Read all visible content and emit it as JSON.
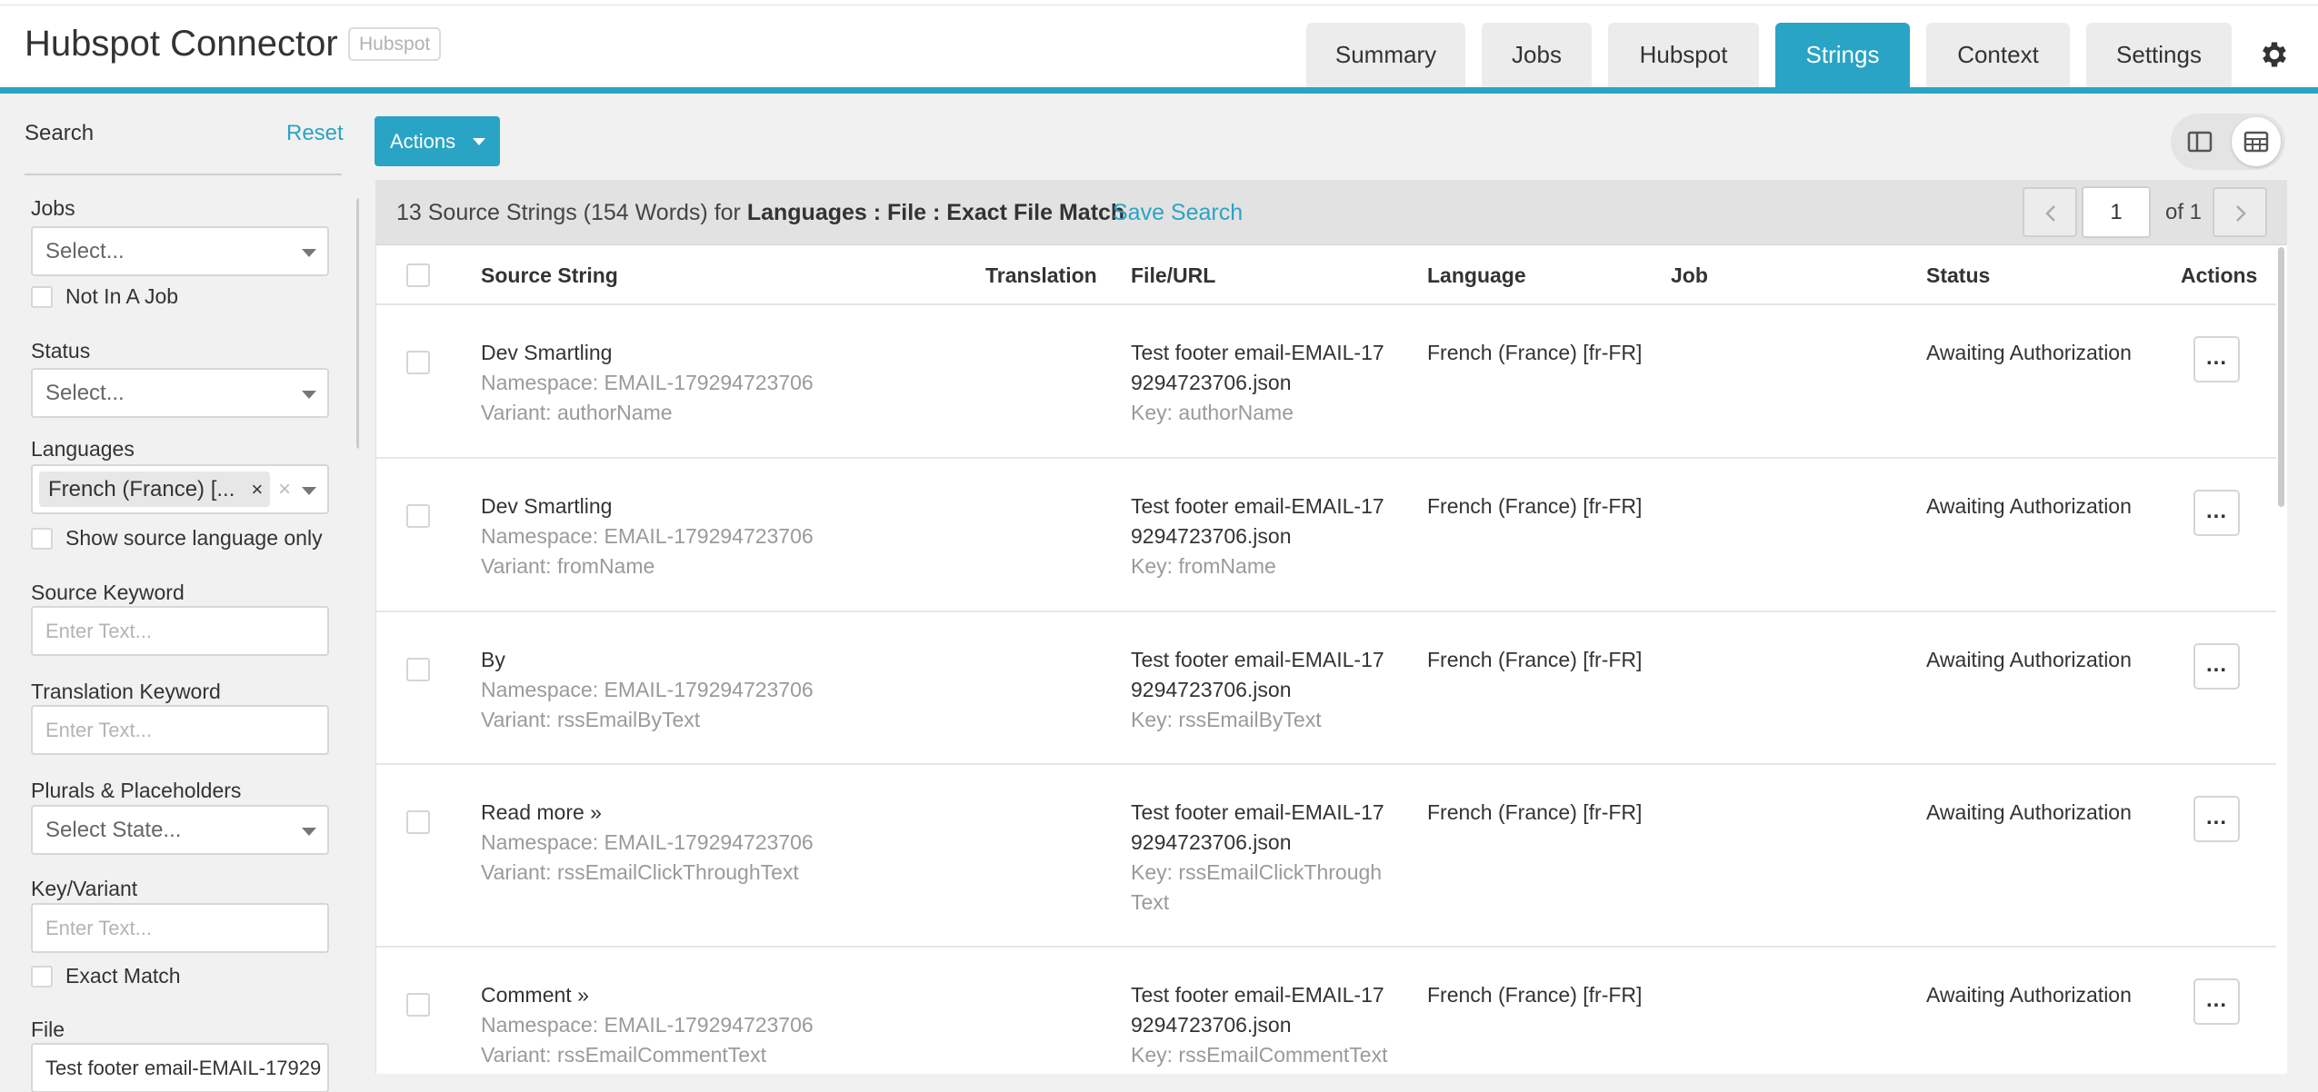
{
  "header": {
    "app_title": "Hubspot Connector",
    "app_tag": "Hubspot",
    "tabs": [
      {
        "label": "Summary",
        "active": false
      },
      {
        "label": "Jobs",
        "active": false
      },
      {
        "label": "Hubspot",
        "active": false
      },
      {
        "label": "Strings",
        "active": true
      },
      {
        "label": "Context",
        "active": false
      },
      {
        "label": "Settings",
        "active": false
      }
    ],
    "settings_icon": "gear-icon"
  },
  "sidebar": {
    "search_label": "Search",
    "reset_label": "Reset",
    "jobs": {
      "label": "Jobs",
      "placeholder": "Select..."
    },
    "not_in_job_label": "Not In A Job",
    "status": {
      "label": "Status",
      "placeholder": "Select..."
    },
    "languages": {
      "label": "Languages",
      "chip": "French (France) [...",
      "chip_remove": "×",
      "clear": "×"
    },
    "show_source_only_label": "Show source language only",
    "source_keyword": {
      "label": "Source Keyword",
      "placeholder": "Enter Text..."
    },
    "translation_keyword": {
      "label": "Translation Keyword",
      "placeholder": "Enter Text..."
    },
    "plurals": {
      "label": "Plurals & Placeholders",
      "placeholder": "Select State..."
    },
    "key_variant": {
      "label": "Key/Variant",
      "placeholder": "Enter Text..."
    },
    "exact_match_label": "Exact Match",
    "file": {
      "label": "File",
      "value": "Test footer email-EMAIL-17929"
    }
  },
  "toolbar": {
    "actions_label": "Actions"
  },
  "results": {
    "summary_prefix": "13 Source Strings (154 Words) for ",
    "summary_filters": "Languages : File : Exact File Match",
    "save_search_label": "Save Search",
    "page_value": "1",
    "page_of": "of 1"
  },
  "table": {
    "columns": {
      "source": "Source String",
      "translation": "Translation",
      "file": "File/URL",
      "language": "Language",
      "job": "Job",
      "status": "Status",
      "actions": "Actions"
    },
    "rows": [
      {
        "source": "Dev Smartling",
        "namespace": "Namespace: EMAIL-179294723706",
        "variant": "Variant: authorName",
        "file1": "Test footer email-EMAIL-17",
        "file2": "9294723706.json",
        "key1": "Key: authorName",
        "key2": "",
        "language": "French (France) [fr-FR]",
        "job": "",
        "status": "Awaiting Authorization",
        "actions": "..."
      },
      {
        "source": "Dev Smartling",
        "namespace": "Namespace: EMAIL-179294723706",
        "variant": "Variant: fromName",
        "file1": "Test footer email-EMAIL-17",
        "file2": "9294723706.json",
        "key1": "Key: fromName",
        "key2": "",
        "language": "French (France) [fr-FR]",
        "job": "",
        "status": "Awaiting Authorization",
        "actions": "..."
      },
      {
        "source": "By",
        "namespace": "Namespace: EMAIL-179294723706",
        "variant": "Variant: rssEmailByText",
        "file1": "Test footer email-EMAIL-17",
        "file2": "9294723706.json",
        "key1": "Key: rssEmailByText",
        "key2": "",
        "language": "French (France) [fr-FR]",
        "job": "",
        "status": "Awaiting Authorization",
        "actions": "..."
      },
      {
        "source": "Read more »",
        "namespace": "Namespace: EMAIL-179294723706",
        "variant": "Variant: rssEmailClickThroughText",
        "file1": "Test footer email-EMAIL-17",
        "file2": "9294723706.json",
        "key1": "Key: rssEmailClickThrough",
        "key2": "Text",
        "language": "French (France) [fr-FR]",
        "job": "",
        "status": "Awaiting Authorization",
        "actions": "..."
      },
      {
        "source": "Comment »",
        "namespace": "Namespace: EMAIL-179294723706",
        "variant": "Variant: rssEmailCommentText",
        "file1": "Test footer email-EMAIL-17",
        "file2": "9294723706.json",
        "key1": "Key: rssEmailCommentText",
        "key2": "",
        "language": "French (France) [fr-FR]",
        "job": "",
        "status": "Awaiting Authorization",
        "actions": "..."
      }
    ]
  },
  "colors": {
    "accent": "#2aa4c4",
    "background": "#f1f1f1",
    "muted_text": "#9a9a9a"
  }
}
